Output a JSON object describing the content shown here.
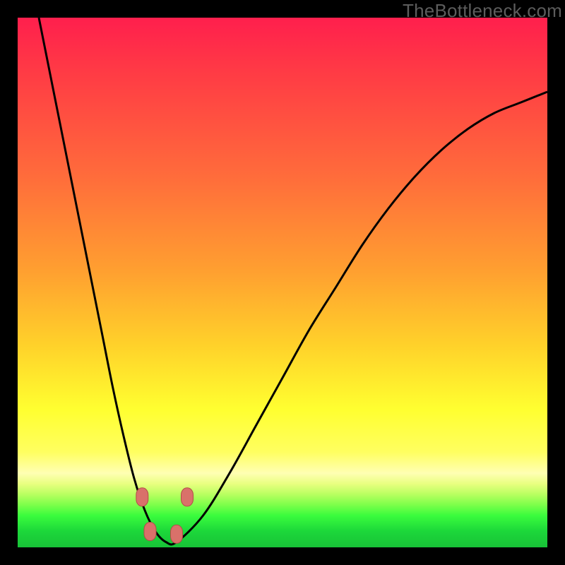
{
  "watermark": "TheBottleneck.com",
  "chart_data": {
    "type": "line",
    "title": "",
    "xlabel": "",
    "ylabel": "",
    "xlim": [
      0,
      100
    ],
    "ylim": [
      0,
      100
    ],
    "series": [
      {
        "name": "bottleneck-curve",
        "x": [
          4,
          6,
          8,
          10,
          12,
          14,
          16,
          18,
          20,
          22,
          24,
          26,
          28,
          30,
          35,
          40,
          45,
          50,
          55,
          60,
          65,
          70,
          75,
          80,
          85,
          90,
          95,
          100
        ],
        "y": [
          100,
          90,
          80,
          70,
          60,
          50,
          40,
          30,
          21,
          13,
          7,
          3,
          1,
          1,
          6,
          14,
          23,
          32,
          41,
          49,
          57,
          64,
          70,
          75,
          79,
          82,
          84,
          86
        ]
      }
    ],
    "markers": [
      {
        "name": "marker-left-upper",
        "x": 23.5,
        "y": 9.5
      },
      {
        "name": "marker-left-lower",
        "x": 25.0,
        "y": 3.0
      },
      {
        "name": "marker-right-lower",
        "x": 30.0,
        "y": 2.5
      },
      {
        "name": "marker-right-upper",
        "x": 32.0,
        "y": 9.5
      }
    ],
    "colors": {
      "curve": "#000000",
      "marker_fill": "#d9716a",
      "marker_stroke": "#b44c47",
      "gradient_top": "#ff1f4d",
      "gradient_bottom": "#18c237"
    }
  }
}
